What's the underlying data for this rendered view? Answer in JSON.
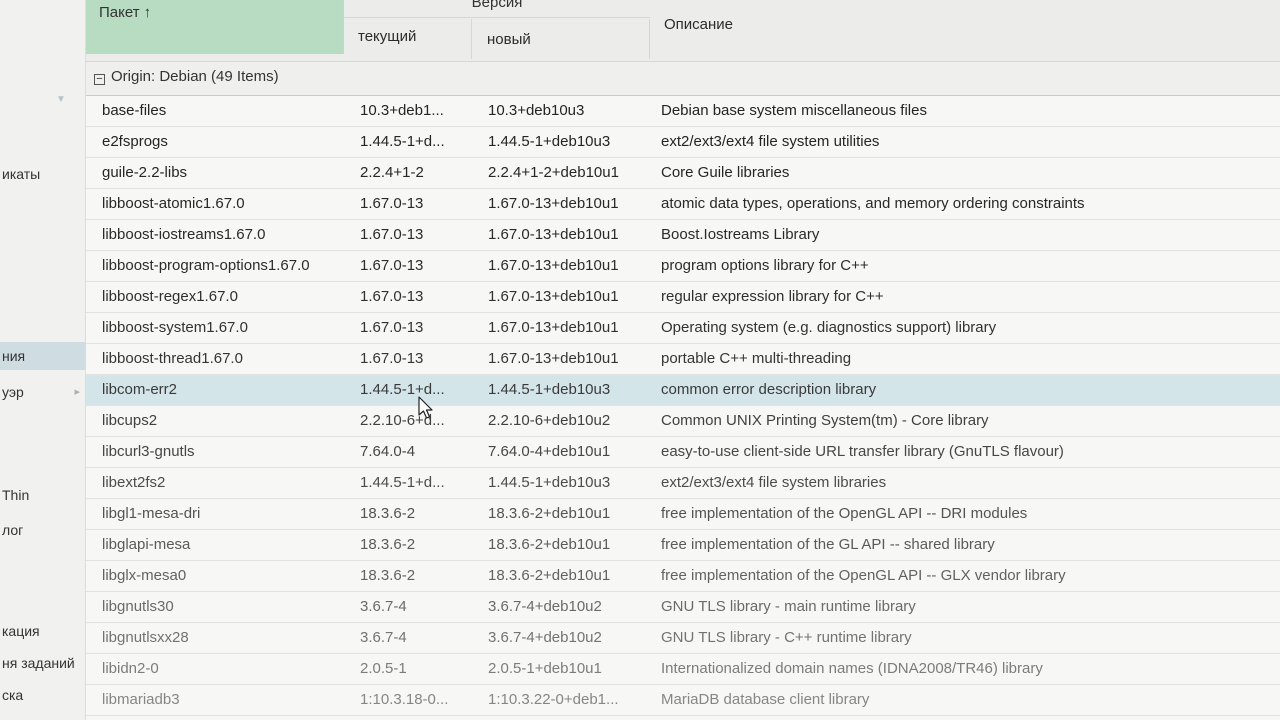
{
  "sidebar": {
    "items": [
      {
        "label": "икаты",
        "active": false,
        "chevron": false
      },
      {
        "label": "ния",
        "active": true,
        "chevron": false
      },
      {
        "label": "уэр",
        "active": false,
        "chevron": true
      },
      {
        "label": "Thin",
        "active": false,
        "chevron": false
      },
      {
        "label": "лог",
        "active": false,
        "chevron": false
      },
      {
        "label": "кация",
        "active": false,
        "chevron": false
      },
      {
        "label": "ня заданий",
        "active": false,
        "chevron": false
      },
      {
        "label": "ска",
        "active": false,
        "chevron": false
      }
    ]
  },
  "table": {
    "columns": {
      "package": "Пакет",
      "sort_arrow": "↑",
      "version": "Версия",
      "current": "текущий",
      "new": "новый",
      "description": "Описание"
    },
    "group": {
      "toggle": "−",
      "label": "Origin: Debian (49 Items)"
    },
    "rows": [
      {
        "name": "base-files",
        "current": "10.3+deb1...",
        "new": "10.3+deb10u3",
        "description": "Debian base system miscellaneous files"
      },
      {
        "name": "e2fsprogs",
        "current": "1.44.5-1+d...",
        "new": "1.44.5-1+deb10u3",
        "description": "ext2/ext3/ext4 file system utilities"
      },
      {
        "name": "guile-2.2-libs",
        "current": "2.2.4+1-2",
        "new": "2.2.4+1-2+deb10u1",
        "description": "Core Guile libraries"
      },
      {
        "name": "libboost-atomic1.67.0",
        "current": "1.67.0-13",
        "new": "1.67.0-13+deb10u1",
        "description": "atomic data types, operations, and memory ordering constraints"
      },
      {
        "name": "libboost-iostreams1.67.0",
        "current": "1.67.0-13",
        "new": "1.67.0-13+deb10u1",
        "description": "Boost.Iostreams Library"
      },
      {
        "name": "libboost-program-options1.67.0",
        "current": "1.67.0-13",
        "new": "1.67.0-13+deb10u1",
        "description": "program options library for C++"
      },
      {
        "name": "libboost-regex1.67.0",
        "current": "1.67.0-13",
        "new": "1.67.0-13+deb10u1",
        "description": "regular expression library for C++"
      },
      {
        "name": "libboost-system1.67.0",
        "current": "1.67.0-13",
        "new": "1.67.0-13+deb10u1",
        "description": "Operating system (e.g. diagnostics support) library"
      },
      {
        "name": "libboost-thread1.67.0",
        "current": "1.67.0-13",
        "new": "1.67.0-13+deb10u1",
        "description": "portable C++ multi-threading"
      },
      {
        "name": "libcom-err2",
        "current": "1.44.5-1+d...",
        "new": "1.44.5-1+deb10u3",
        "description": "common error description library"
      },
      {
        "name": "libcups2",
        "current": "2.2.10-6+d...",
        "new": "2.2.10-6+deb10u2",
        "description": "Common UNIX Printing System(tm) - Core library"
      },
      {
        "name": "libcurl3-gnutls",
        "current": "7.64.0-4",
        "new": "7.64.0-4+deb10u1",
        "description": "easy-to-use client-side URL transfer library (GnuTLS flavour)"
      },
      {
        "name": "libext2fs2",
        "current": "1.44.5-1+d...",
        "new": "1.44.5-1+deb10u3",
        "description": "ext2/ext3/ext4 file system libraries"
      },
      {
        "name": "libgl1-mesa-dri",
        "current": "18.3.6-2",
        "new": "18.3.6-2+deb10u1",
        "description": "free implementation of the OpenGL API -- DRI modules"
      },
      {
        "name": "libglapi-mesa",
        "current": "18.3.6-2",
        "new": "18.3.6-2+deb10u1",
        "description": "free implementation of the GL API -- shared library"
      },
      {
        "name": "libglx-mesa0",
        "current": "18.3.6-2",
        "new": "18.3.6-2+deb10u1",
        "description": "free implementation of the OpenGL API -- GLX vendor library"
      },
      {
        "name": "libgnutls30",
        "current": "3.6.7-4",
        "new": "3.6.7-4+deb10u2",
        "description": "GNU TLS library - main runtime library"
      },
      {
        "name": "libgnutlsxx28",
        "current": "3.6.7-4",
        "new": "3.6.7-4+deb10u2",
        "description": "GNU TLS library - C++ runtime library"
      },
      {
        "name": "libidn2-0",
        "current": "2.0.5-1",
        "new": "2.0.5-1+deb10u1",
        "description": "Internationalized domain names (IDNA2008/TR46) library"
      },
      {
        "name": "libmariadb3",
        "current": "1:10.3.18-0...",
        "new": "1:10.3.22-0+deb1...",
        "description": "MariaDB database client library"
      }
    ]
  },
  "colors": {
    "sort_header_bg": "#b7dcc1",
    "selected_row_bg": "#d4e5ea",
    "sidebar_active_bg": "#cfdde3"
  },
  "icons": [
    "sort-ascending-icon",
    "collapse-group-icon",
    "mouse-cursor-icon",
    "chevron-down-icon"
  ]
}
